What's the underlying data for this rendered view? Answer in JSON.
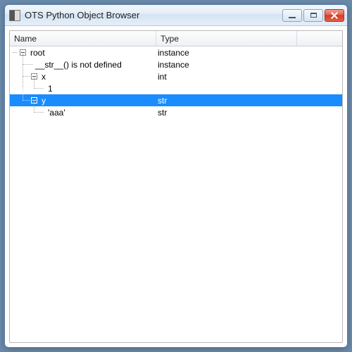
{
  "window": {
    "title": "OTS Python Object Browser"
  },
  "columns": {
    "name": "Name",
    "type": "Type"
  },
  "tree": {
    "root": {
      "name": "root",
      "type": "instance",
      "expanded": true,
      "children": {
        "strdef": {
          "name": "__str__() is not defined",
          "type": "instance"
        },
        "x": {
          "name": "x",
          "type": "int",
          "expanded": true,
          "value": {
            "name": "1",
            "type": ""
          }
        },
        "y": {
          "name": "y",
          "type": "str",
          "expanded": true,
          "selected": true,
          "value": {
            "name": "'aaa'",
            "type": "str"
          }
        }
      }
    }
  }
}
